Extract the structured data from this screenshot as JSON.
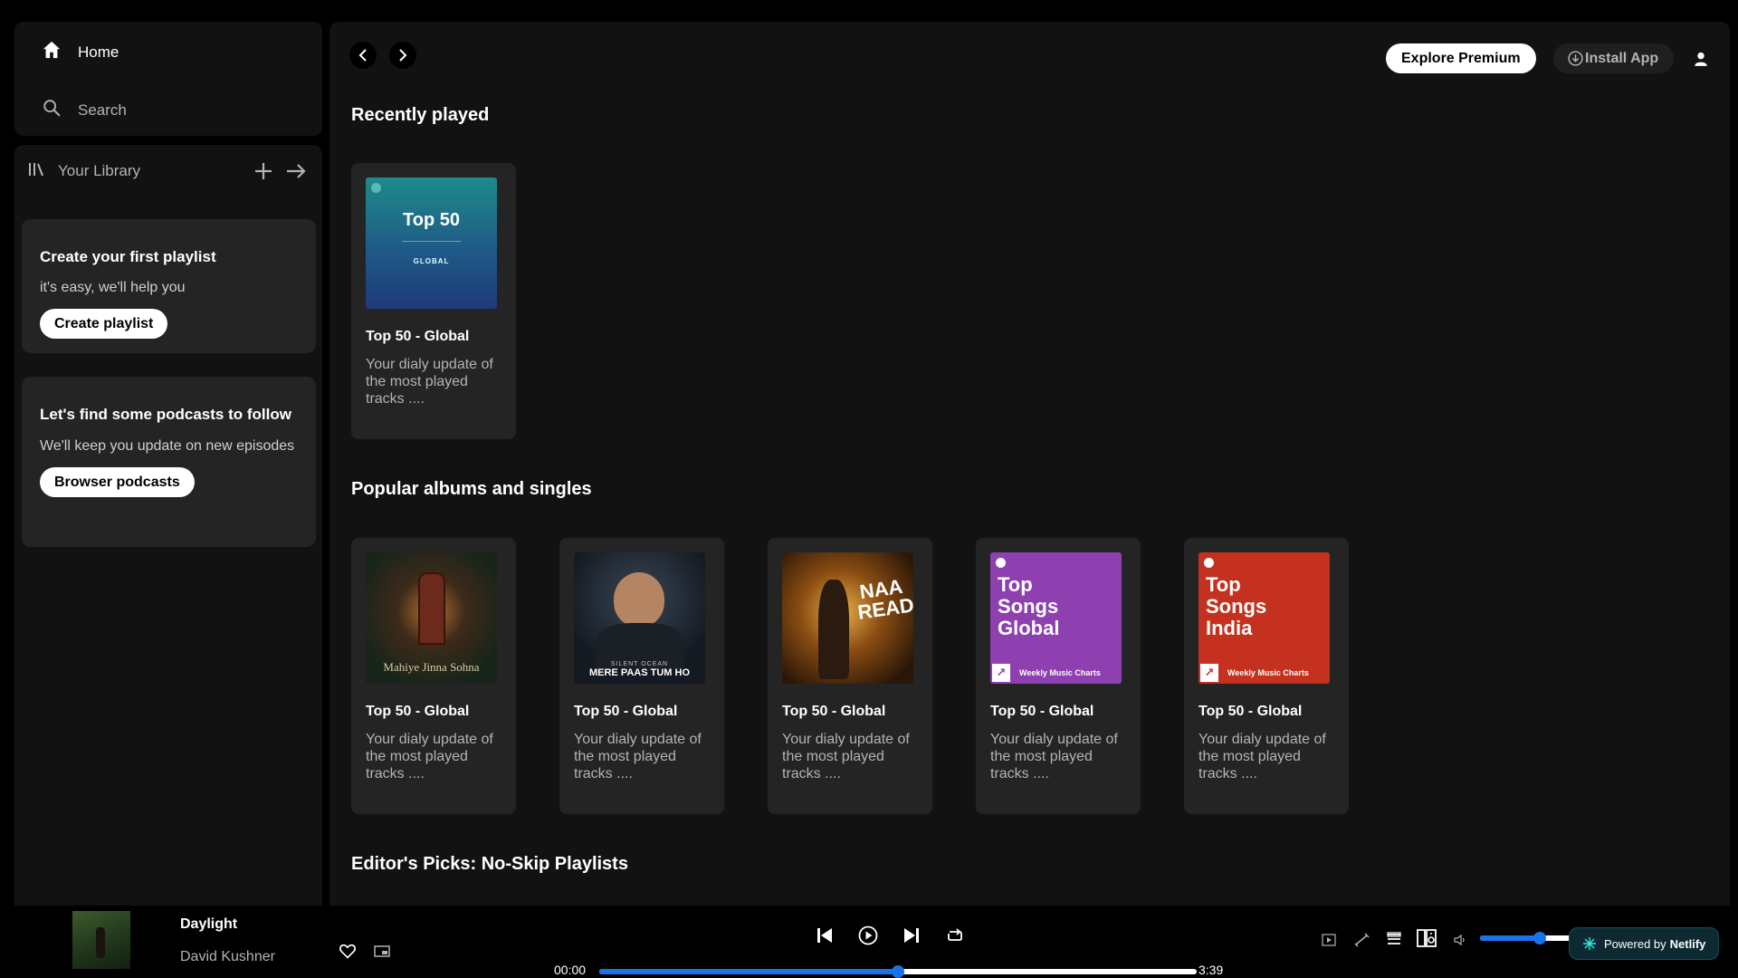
{
  "nav": {
    "home": "Home",
    "search": "Search"
  },
  "library": {
    "label": "Your Library",
    "playlist_card": {
      "title": "Create your first playlist",
      "text": "it's easy, we'll help you",
      "button": "Create playlist"
    },
    "podcast_card": {
      "title": "Let's find some podcasts to follow",
      "text": "We'll keep you update on new episodes",
      "button": "Browser podcasts"
    }
  },
  "header": {
    "premium": "Explore Premium",
    "install": "Install App"
  },
  "sections": {
    "recent": "Recently played",
    "popular": "Popular albums and singles",
    "editors": "Editor's Picks: No-Skip Playlists"
  },
  "recent_cards": [
    {
      "title": "Top 50 - Global",
      "desc": "Your dialy update of the most played tracks ....",
      "cover_title": "Top 50",
      "cover_sub": "GLOBAL"
    }
  ],
  "album_cards": [
    {
      "title": "Top 50 - Global",
      "desc": "Your dialy update of the most played tracks ....",
      "cover_text": "Mahiye Jinna Sohna"
    },
    {
      "title": "Top 50 - Global",
      "desc": "Your dialy update of the most played tracks ....",
      "cover_text": "MERE PAAS TUM HO",
      "cover_sub": "SILENT OCEAN"
    },
    {
      "title": "Top 50 - Global",
      "desc": "Your dialy update of the most played tracks ....",
      "cover_text": "NAA READY"
    },
    {
      "title": "Top 50 - Global",
      "desc": "Your dialy update of the most played tracks ....",
      "cover_text": "Top Songs Global",
      "cover_sub": "Weekly Music Charts"
    },
    {
      "title": "Top 50 - Global",
      "desc": "Your dialy update of the most played tracks ....",
      "cover_text": "Top Songs India",
      "cover_sub": "Weekly Music Charts"
    }
  ],
  "player": {
    "title": "Daylight",
    "artist": "David Kushner",
    "elapsed": "00:00",
    "duration": "3:39",
    "progress": 0.5,
    "volume": 0.6
  },
  "badge": {
    "prefix": "Powered by",
    "brand": "Netlify"
  },
  "colors": {
    "accent": "#1a73e8",
    "panel": "#121212",
    "card": "#242424"
  }
}
